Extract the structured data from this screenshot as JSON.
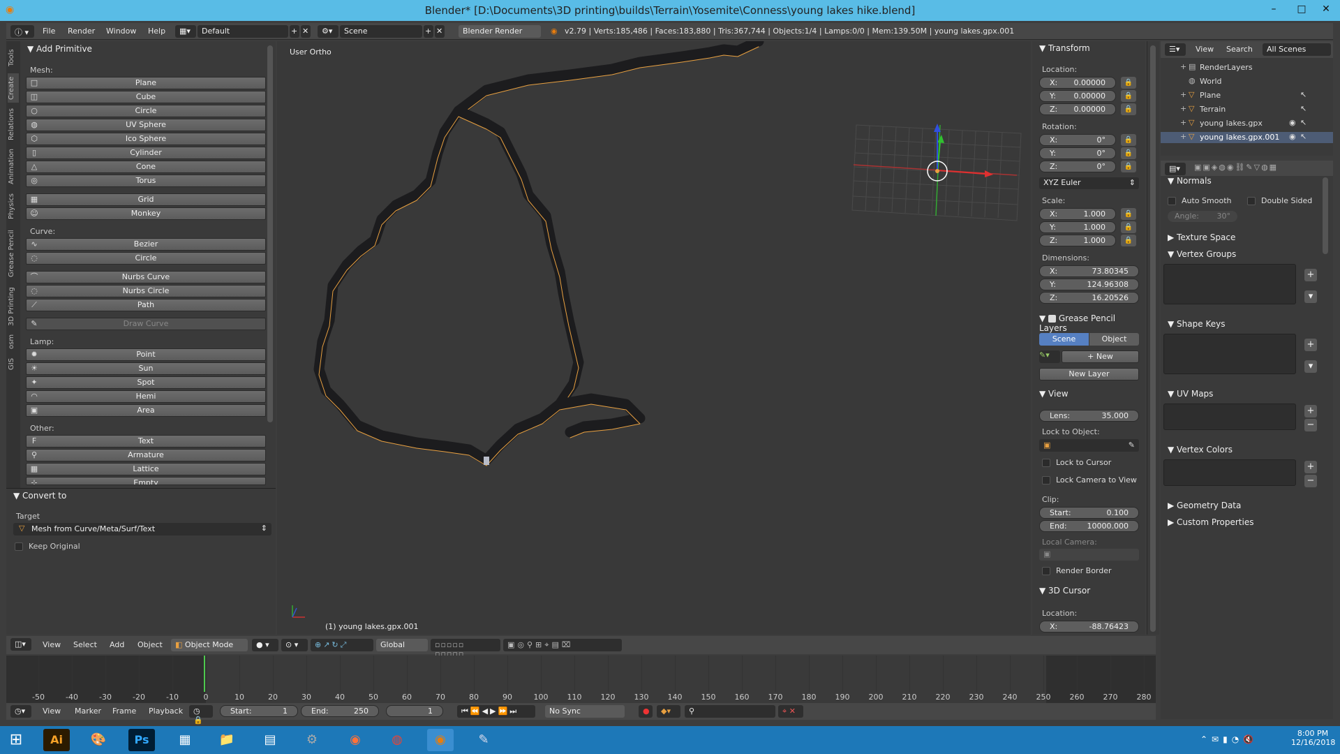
{
  "window": {
    "title": "Blender* [D:\\Documents\\3D printing\\builds\\Terrain\\Yosemite\\Conness\\young lakes hike.blend]",
    "minimize": "–",
    "maximize": "□",
    "close": "✕"
  },
  "topbar": {
    "menus": [
      "File",
      "Render",
      "Window",
      "Help"
    ],
    "layout": "Default",
    "scene": "Scene",
    "engine": "Blender Render",
    "stats": "v2.79 | Verts:185,486 | Faces:183,880 | Tris:367,744 | Objects:1/4 | Lamps:0/0 | Mem:139.50M | young lakes.gpx.001"
  },
  "vtabs": [
    "Tools",
    "Create",
    "Relations",
    "Animation",
    "Physics",
    "Grease Pencil",
    "3D Printing",
    "osm",
    "GIS"
  ],
  "add_primitive": {
    "title": "Add Primitive",
    "mesh_label": "Mesh:",
    "mesh": [
      "Plane",
      "Cube",
      "Circle",
      "UV Sphere",
      "Ico Sphere",
      "Cylinder",
      "Cone",
      "Torus"
    ],
    "mesh2": [
      "Grid",
      "Monkey"
    ],
    "curve_label": "Curve:",
    "curve": [
      "Bezier",
      "Circle"
    ],
    "curve2": [
      "Nurbs Curve",
      "Nurbs Circle",
      "Path"
    ],
    "draw_curve": "Draw Curve",
    "lamp_label": "Lamp:",
    "lamp": [
      "Point",
      "Sun",
      "Spot",
      "Hemi",
      "Area"
    ],
    "other_label": "Other:",
    "other": [
      "Text",
      "Armature",
      "Lattice",
      "Empty"
    ]
  },
  "convert_to": {
    "title": "Convert to",
    "target_label": "Target",
    "target_value": "Mesh from Curve/Meta/Surf/Text",
    "keep_original": "Keep Original"
  },
  "viewport": {
    "view_name": "User Ortho",
    "object_label": "(1) young lakes.gpx.001"
  },
  "transform": {
    "title": "Transform",
    "location_label": "Location:",
    "location": [
      {
        "k": "X:",
        "v": "0.00000"
      },
      {
        "k": "Y:",
        "v": "0.00000"
      },
      {
        "k": "Z:",
        "v": "0.00000"
      }
    ],
    "rotation_label": "Rotation:",
    "rotation": [
      {
        "k": "X:",
        "v": "0°"
      },
      {
        "k": "Y:",
        "v": "0°"
      },
      {
        "k": "Z:",
        "v": "0°"
      }
    ],
    "rotation_mode": "XYZ Euler",
    "scale_label": "Scale:",
    "scale": [
      {
        "k": "X:",
        "v": "1.000"
      },
      {
        "k": "Y:",
        "v": "1.000"
      },
      {
        "k": "Z:",
        "v": "1.000"
      }
    ],
    "dimensions_label": "Dimensions:",
    "dimensions": [
      {
        "k": "X:",
        "v": "73.80345"
      },
      {
        "k": "Y:",
        "v": "124.96308"
      },
      {
        "k": "Z:",
        "v": "16.20526"
      }
    ]
  },
  "grease_pencil": {
    "title": "Grease Pencil Layers",
    "scene_tab": "Scene",
    "object_tab": "Object",
    "new_btn": "New",
    "new_layer_btn": "New Layer"
  },
  "view_panel": {
    "title": "View",
    "lens_k": "Lens:",
    "lens_v": "35.000",
    "lock_to_object": "Lock to Object:",
    "lock_cursor": "Lock to Cursor",
    "lock_camera": "Lock Camera to View",
    "clip_label": "Clip:",
    "clip_start_k": "Start:",
    "clip_start_v": "0.100",
    "clip_end_k": "End:",
    "clip_end_v": "10000.000",
    "local_camera": "Local Camera:",
    "render_border": "Render Border"
  },
  "cursor_panel": {
    "title": "3D Cursor",
    "location_label": "Location:",
    "x_k": "X:",
    "x_v": "-88.76423"
  },
  "outliner": {
    "view": "View",
    "search": "Search",
    "scope": "All Scenes",
    "items": [
      "RenderLayers",
      "World",
      "Plane",
      "Terrain",
      "young lakes.gpx",
      "young lakes.gpx.001"
    ]
  },
  "properties": {
    "normals": "Normals",
    "auto_smooth": "Auto Smooth",
    "double_sided": "Double Sided",
    "angle": "Angle:",
    "angle_v": "30°",
    "texture_space": "Texture Space",
    "vertex_groups": "Vertex Groups",
    "shape_keys": "Shape Keys",
    "uv_maps": "UV Maps",
    "vertex_colors": "Vertex Colors",
    "geometry_data": "Geometry Data",
    "custom_properties": "Custom Properties"
  },
  "vp_header": {
    "menus": [
      "View",
      "Select",
      "Add",
      "Object"
    ],
    "mode": "Object Mode",
    "orientation": "Global"
  },
  "timeline": {
    "ticks": [
      "-50",
      "-40",
      "-30",
      "-20",
      "-10",
      "0",
      "10",
      "20",
      "30",
      "40",
      "50",
      "60",
      "70",
      "80",
      "90",
      "100",
      "110",
      "120",
      "130",
      "140",
      "150",
      "160",
      "170",
      "180",
      "190",
      "200",
      "210",
      "220",
      "230",
      "240",
      "250",
      "260",
      "270",
      "280"
    ],
    "menus": [
      "View",
      "Marker",
      "Frame",
      "Playback"
    ],
    "start_k": "Start:",
    "start_v": "1",
    "end_k": "End:",
    "end_v": "250",
    "current": "1",
    "sync": "No Sync"
  },
  "taskbar": {
    "time": "8:00 PM",
    "date": "12/16/2018",
    "apps": [
      "Ai",
      "Ps"
    ]
  },
  "colors": {
    "accent": "#59bce6",
    "select_orange": "#e8a040",
    "scene_tab": "#5680c2"
  }
}
